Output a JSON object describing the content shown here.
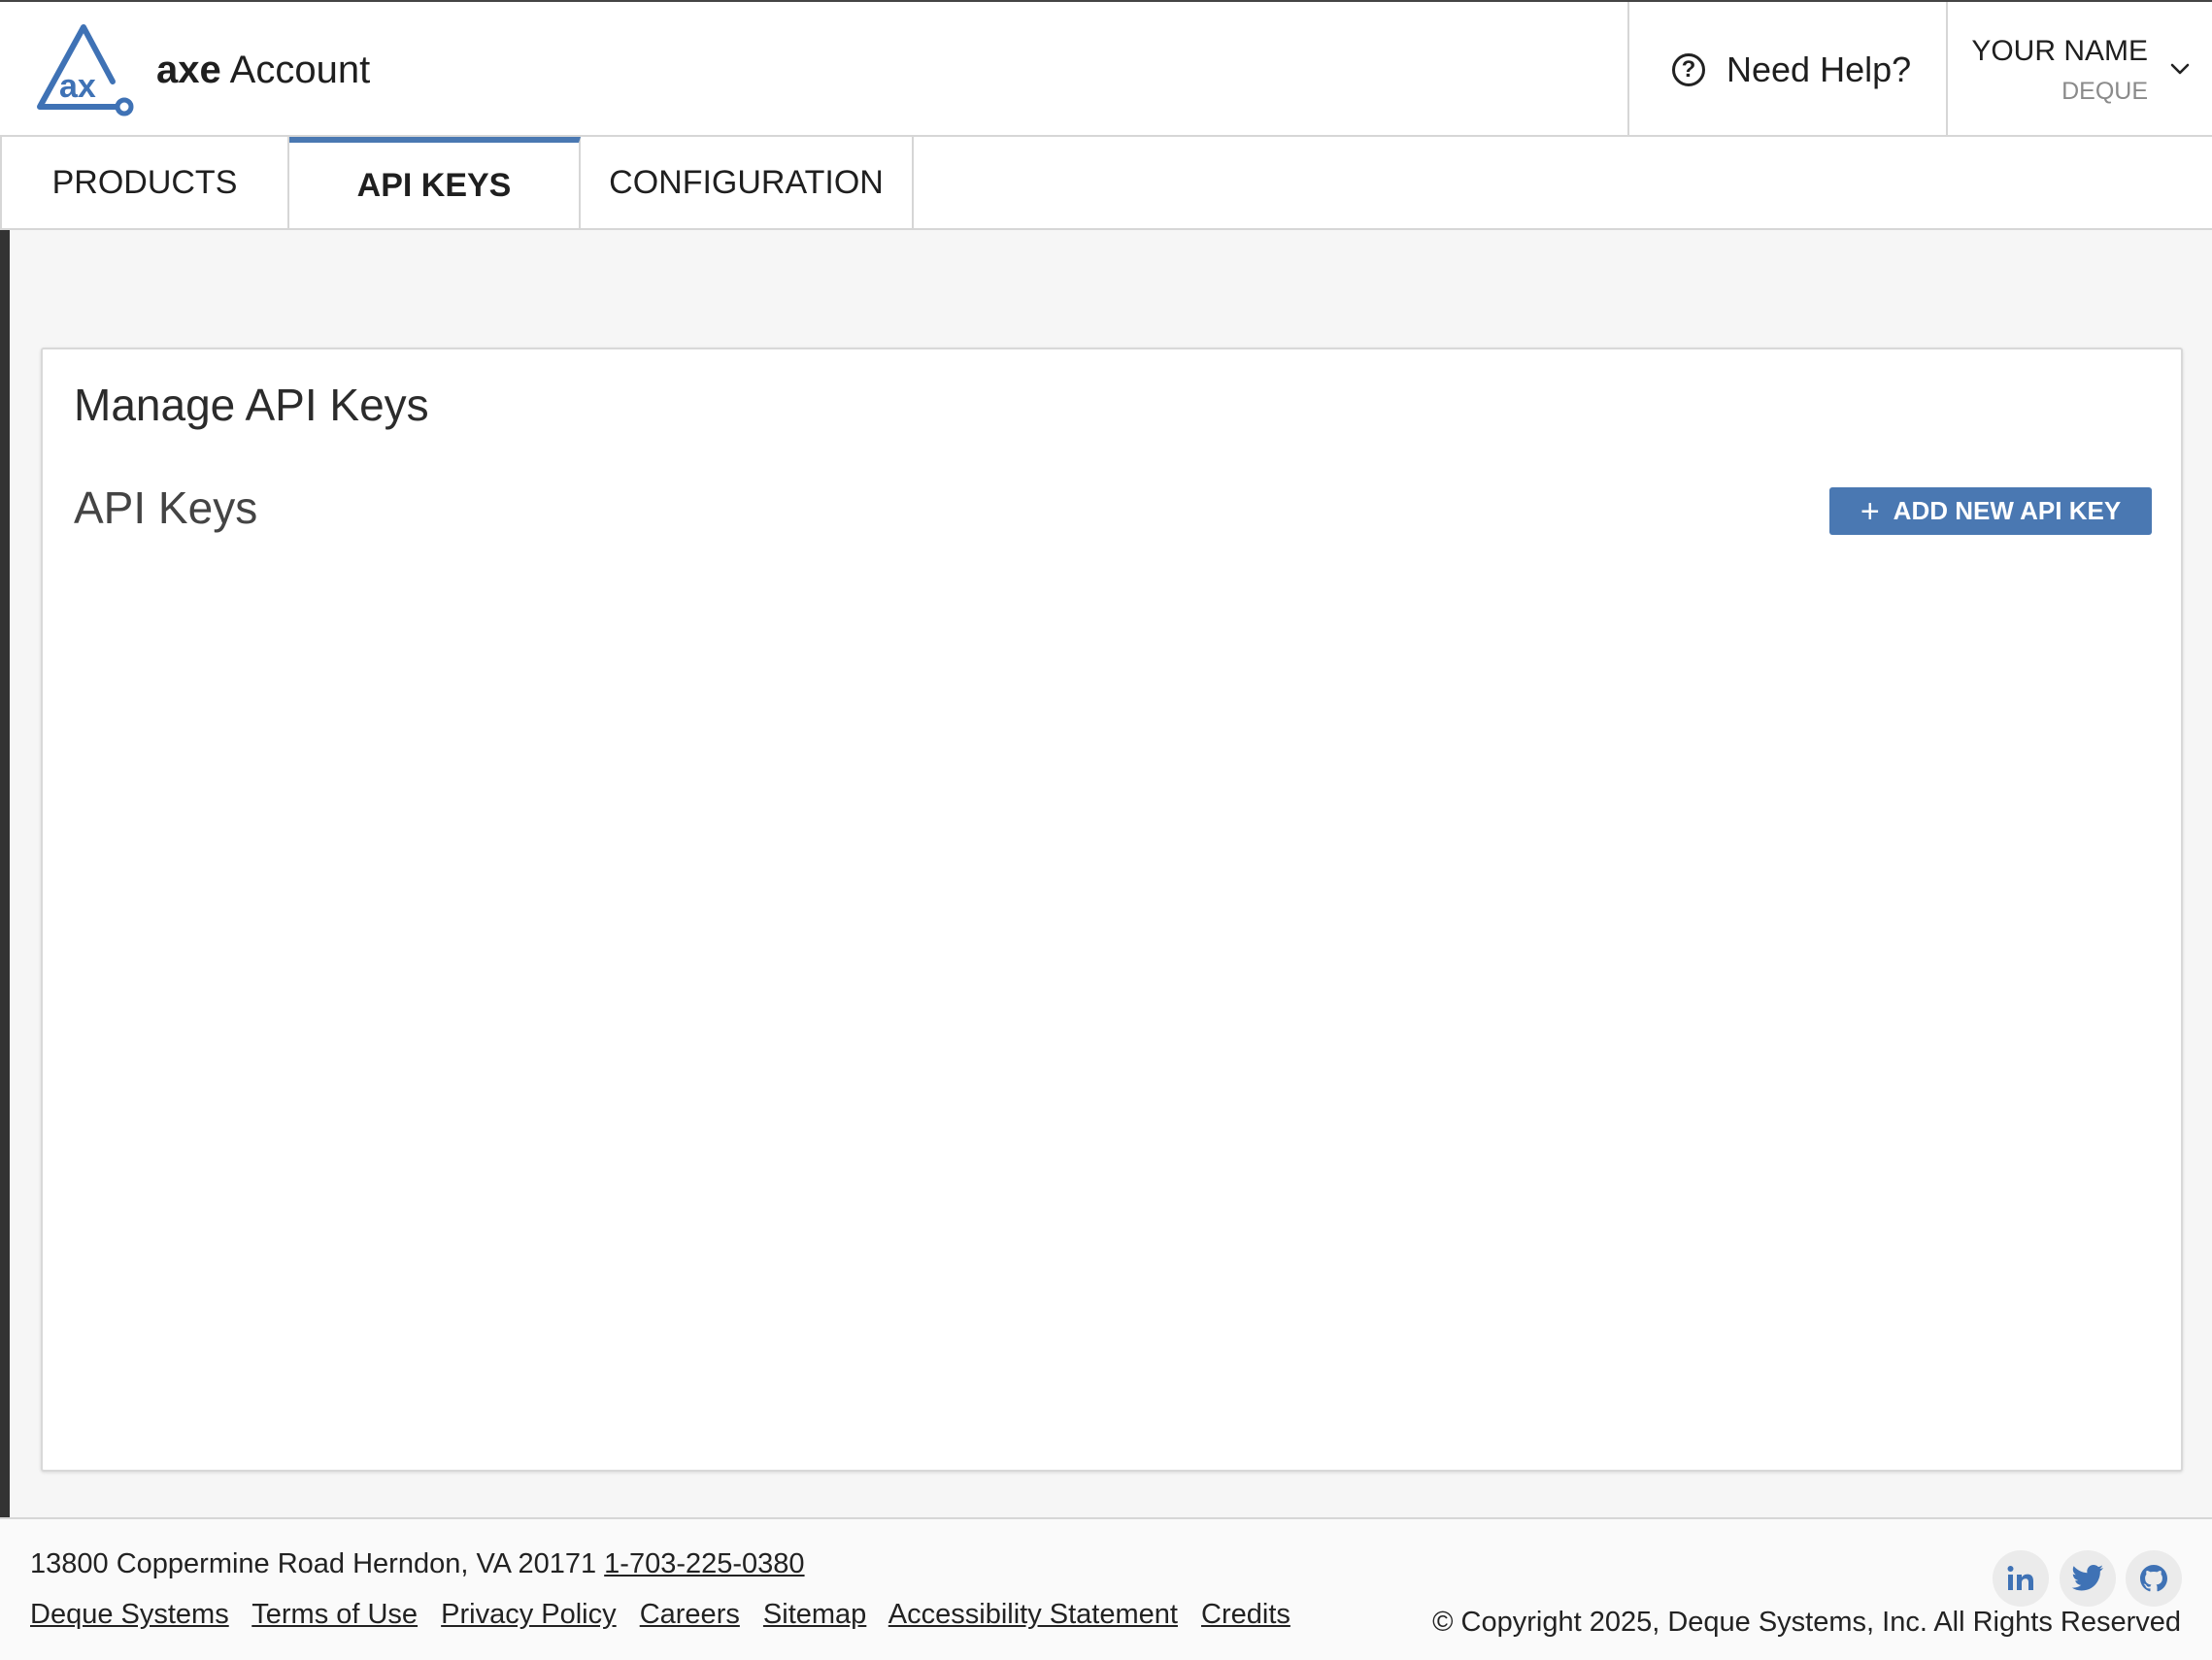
{
  "header": {
    "brand_bold": "axe",
    "brand_light": " Account",
    "help_label": "Need Help?",
    "user_name": "YOUR NAME",
    "user_org": "DEQUE",
    "accent_color": "#4a78b2"
  },
  "tabs": [
    {
      "label": "PRODUCTS",
      "active": false
    },
    {
      "label": "API KEYS",
      "active": true
    },
    {
      "label": "CONFIGURATION",
      "active": false
    }
  ],
  "main": {
    "page_title": "Manage API Keys",
    "section_title": "API Keys",
    "add_button_label": "ADD NEW API KEY",
    "add_button_icon": "plus-icon"
  },
  "footer": {
    "address": "13800 Coppermine Road Herndon, VA 20171",
    "phone": "1-703-225-0380",
    "links": [
      "Deque Systems",
      "Terms of Use",
      "Privacy Policy",
      "Careers",
      "Sitemap",
      "Accessibility Statement",
      "Credits"
    ],
    "copyright": "© Copyright 2025, Deque Systems, Inc. All Rights Reserved",
    "social_icons": [
      "linkedin-icon",
      "twitter-icon",
      "github-icon"
    ]
  }
}
